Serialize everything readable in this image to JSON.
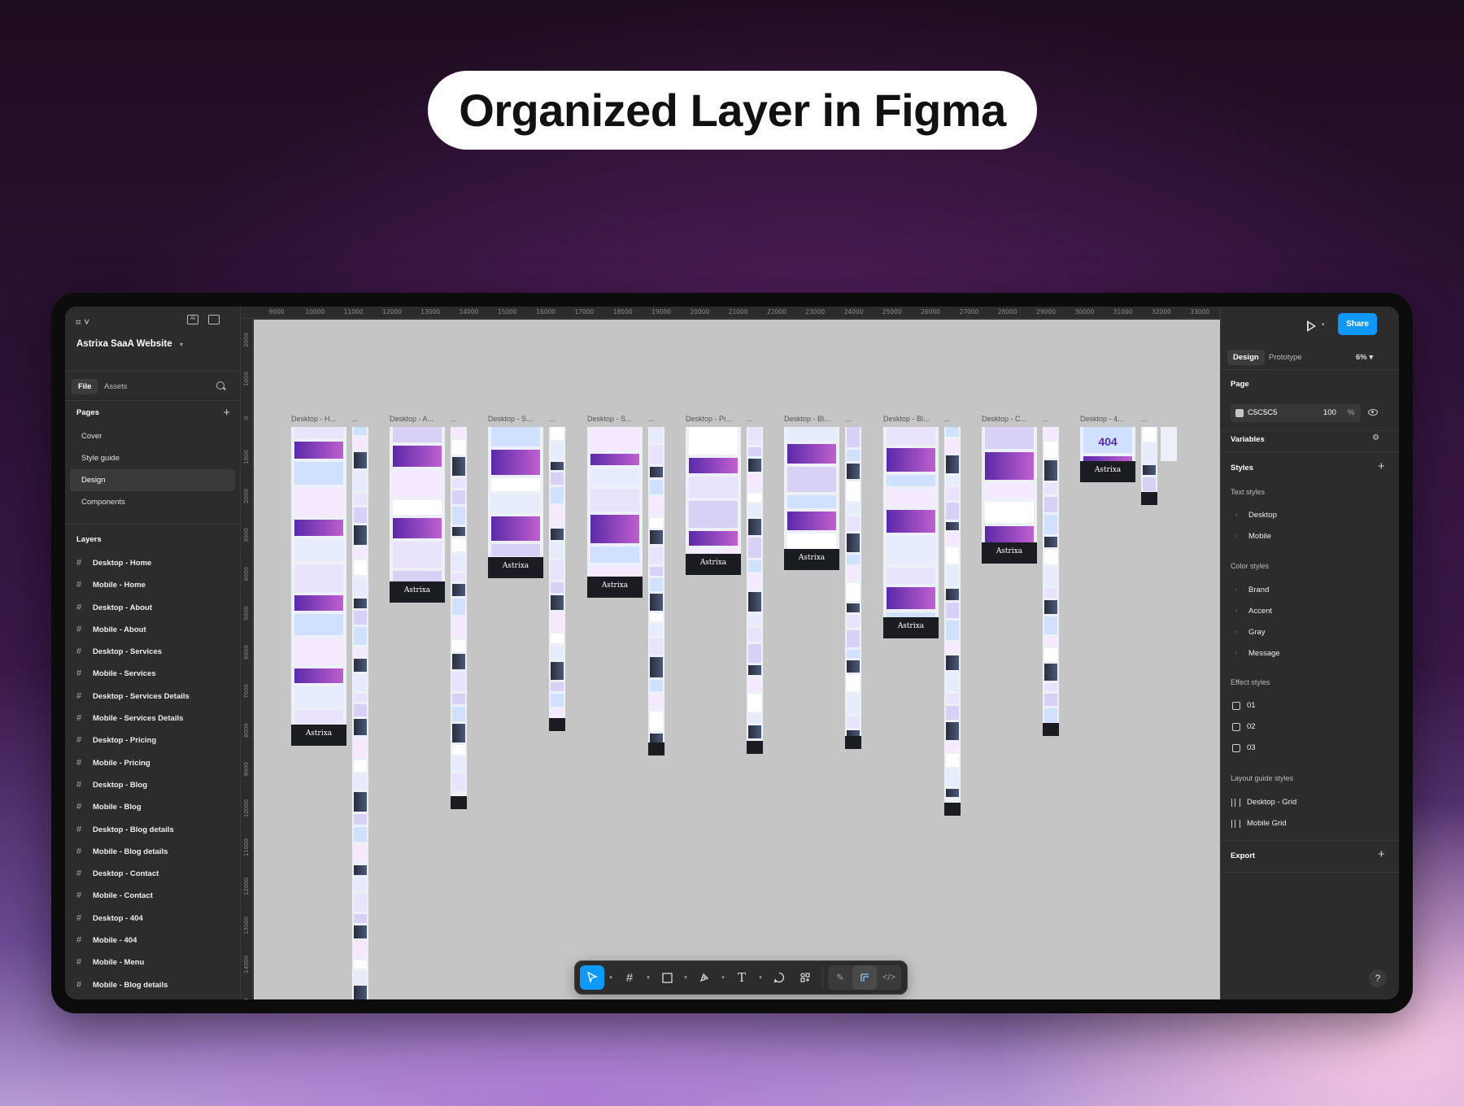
{
  "headline": "Organized Layer in Figma",
  "app": {
    "project_name": "Astrixa SaaA Website",
    "left_tabs": {
      "file": "File",
      "assets": "Assets"
    },
    "pages_title": "Pages",
    "pages": [
      {
        "label": "Cover",
        "active": false
      },
      {
        "label": "Style guide",
        "active": false
      },
      {
        "label": "Design",
        "active": true
      },
      {
        "label": "Components",
        "active": false
      }
    ],
    "layers_title": "Layers",
    "layers": [
      "Desktop - Home",
      "Mobile - Home",
      "Desktop - About",
      "Mobile - About",
      "Desktop - Services",
      "Mobile - Services",
      "Desktop - Services Details",
      "Mobile - Services Details",
      "Desktop - Pricing",
      "Mobile - Pricing",
      "Desktop - Blog",
      "Mobile - Blog",
      "Desktop - Blog details",
      "Mobile - Blog details",
      "Desktop - Contact",
      "Mobile - Contact",
      "Desktop - 404",
      "Mobile - 404",
      "Mobile - Menu",
      "Mobile - Blog details"
    ],
    "ruler_top": [
      "9000",
      "10000",
      "11000",
      "12000",
      "13000",
      "14000",
      "15000",
      "16000",
      "17000",
      "18000",
      "19000",
      "20000",
      "21000",
      "22000",
      "23000",
      "24000",
      "25000",
      "26000",
      "27000",
      "28000",
      "29000",
      "30000",
      "31000",
      "32000",
      "33000"
    ],
    "ruler_left": [
      "2000",
      "1000",
      "0",
      "1000",
      "2000",
      "3000",
      "4000",
      "5000",
      "6000",
      "7000",
      "8000",
      "9000",
      "10000",
      "11000",
      "12000",
      "13000",
      "14000",
      "100"
    ],
    "frames": [
      {
        "label": "Desktop - H...",
        "mobile_label": "..."
      },
      {
        "label": "Desktop - A...",
        "mobile_label": "..."
      },
      {
        "label": "Desktop - S...",
        "mobile_label": "..."
      },
      {
        "label": "Desktop - S...",
        "mobile_label": "..."
      },
      {
        "label": "Desktop - Pr...",
        "mobile_label": "..."
      },
      {
        "label": "Desktop - Bl...",
        "mobile_label": "..."
      },
      {
        "label": "Desktop - Bl...",
        "mobile_label": "..."
      },
      {
        "label": "Desktop - C...",
        "mobile_label": "..."
      },
      {
        "label": "Desktop - 4...",
        "mobile_label": "..."
      }
    ],
    "frame_brand_text": "Astrixa",
    "not_found_text": "404",
    "right_panel": {
      "share": "Share",
      "tabs": {
        "design": "Design",
        "prototype": "Prototype"
      },
      "zoom": "6%",
      "page_title": "Page",
      "fill_hex": "C5C5C5",
      "fill_opacity": "100",
      "fill_pct": "%",
      "variables": "Variables",
      "styles": "Styles",
      "text_styles_title": "Text styles",
      "text_styles": [
        "Desktop",
        "Mobile"
      ],
      "color_styles_title": "Color styles",
      "color_styles": [
        "Brand",
        "Accent",
        "Gray",
        "Message"
      ],
      "effect_styles_title": "Effect styles",
      "effect_styles": [
        "01",
        "02",
        "03"
      ],
      "layout_guide_title": "Layout guide styles",
      "layout_guides": [
        "Desktop - Grid",
        "Mobile Grid"
      ],
      "export": "Export",
      "help": "?"
    },
    "colors": {
      "accent": "#0d99ff",
      "canvas": "#c5c5c5",
      "panel": "#2c2c2c"
    }
  }
}
